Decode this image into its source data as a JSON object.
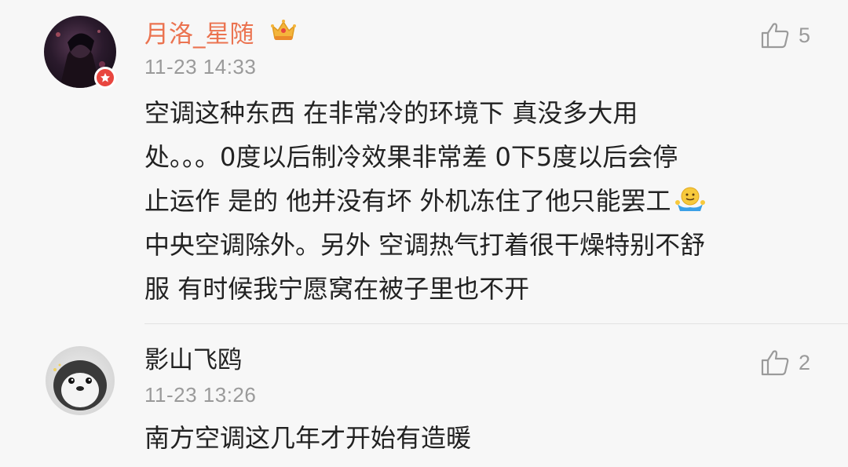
{
  "comments": [
    {
      "username": "月洛_星随",
      "badge_icon": "crown-vip-icon",
      "time": "11-23 14:33",
      "likes": "5",
      "body_lines": [
        "空调这种东西 在非常冷的环境下 真没多大用",
        "处。。。0度以后制冷效果非常差 0下5度以后会停",
        "止运作 是的 他并没有坏 外机冻住了他只能罢工",
        "中央空调除外。另外 空调热气打着很干燥特别不舒",
        "服 有时候我宁愿窝在被子里也不开"
      ],
      "inline_emoji": "shrug-emoji",
      "username_color": "#eb7350"
    },
    {
      "username": "影山飞鸥",
      "time": "11-23 13:26",
      "likes": "2",
      "body_lines": [
        "南方空调这几年才开始有造暖"
      ],
      "username_color": "#222222"
    }
  ],
  "colors": {
    "background": "#f7f7f7",
    "meta_gray": "#9a9a9a",
    "accent_orange": "#eb7350"
  }
}
